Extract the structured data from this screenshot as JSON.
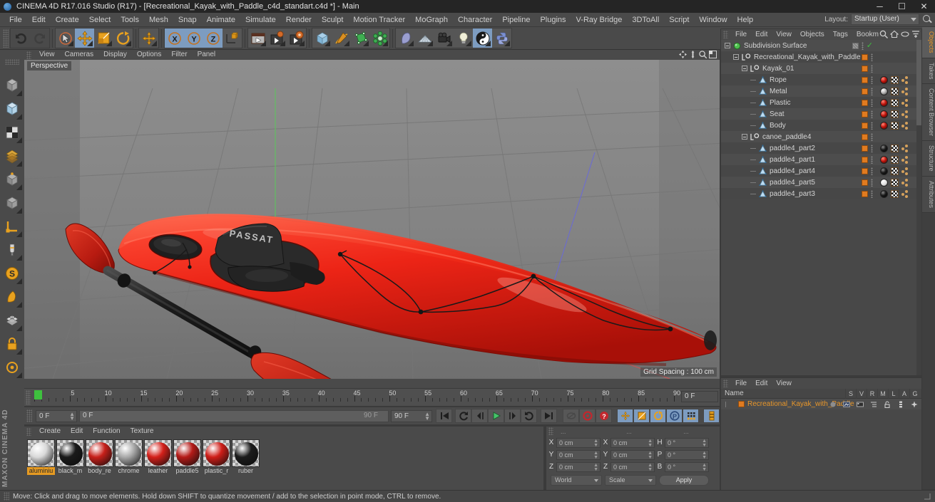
{
  "window": {
    "title": "CINEMA 4D R17.016 Studio (R17) - [Recreational_Kayak_with_Paddle_c4d_standart.c4d *] - Main",
    "minimize": "─",
    "maximize": "☐",
    "close": "✕"
  },
  "menubar": {
    "items": [
      "File",
      "Edit",
      "Create",
      "Select",
      "Tools",
      "Mesh",
      "Snap",
      "Animate",
      "Simulate",
      "Render",
      "Sculpt",
      "Motion Tracker",
      "MoGraph",
      "Character",
      "Pipeline",
      "Plugins",
      "V-Ray Bridge",
      "3DToAll",
      "Script",
      "Window",
      "Help"
    ],
    "layout_label": "Layout:",
    "layout_value": "Startup (User)"
  },
  "viewport": {
    "menu": [
      "View",
      "Cameras",
      "Display",
      "Options",
      "Filter",
      "Panel"
    ],
    "label": "Perspective",
    "grid_spacing": "Grid Spacing : 100 cm",
    "axis_x": "X",
    "axis_y": "Y",
    "axis_z": "Z",
    "hud_logo": "PASSAT"
  },
  "timeline": {
    "ticks": [
      0,
      5,
      10,
      15,
      20,
      25,
      30,
      35,
      40,
      45,
      50,
      55,
      60,
      65,
      70,
      75,
      80,
      85,
      90
    ],
    "current_frame_field": "0 F",
    "range_start": "0 F",
    "range_min": "0 F",
    "range_max": "90 F",
    "range_end": "90 F"
  },
  "material_manager": {
    "menu": [
      "Create",
      "Edit",
      "Function",
      "Texture"
    ],
    "materials": [
      {
        "name": "aluminiu",
        "color": "#d9d9d9",
        "selected": true
      },
      {
        "name": "black_m",
        "color": "#1a1a1a",
        "selected": false
      },
      {
        "name": "body_re",
        "color": "#c7201a",
        "selected": false
      },
      {
        "name": "chrome",
        "color": "#a9a9a9",
        "selected": false
      },
      {
        "name": "leather",
        "color": "#d4201a",
        "selected": false
      },
      {
        "name": "paddle5",
        "color": "#b51b18",
        "selected": false
      },
      {
        "name": "plastic_r",
        "color": "#cf1e18",
        "selected": false
      },
      {
        "name": "ruber",
        "color": "#1c1c1c",
        "selected": false
      }
    ]
  },
  "coordinates": {
    "header": [
      "...",
      "...",
      "..."
    ],
    "rows": [
      {
        "label1": "X",
        "value1": "0 cm",
        "label2": "X",
        "value2": "0 cm",
        "label3": "H",
        "value3": "0 °"
      },
      {
        "label1": "Y",
        "value1": "0 cm",
        "label2": "Y",
        "value2": "0 cm",
        "label3": "P",
        "value3": "0 °"
      },
      {
        "label1": "Z",
        "value1": "0 cm",
        "label2": "Z",
        "value2": "0 cm",
        "label3": "B",
        "value3": "0 °"
      }
    ],
    "world_select": "World",
    "scale_select": "Scale",
    "apply_button": "Apply"
  },
  "object_manager": {
    "menu": [
      "File",
      "Edit",
      "View",
      "Objects",
      "Tags",
      "Bookm"
    ],
    "rows": [
      {
        "label": "Subdivision Surface",
        "depth": 0,
        "expander": "minus",
        "icon": "subdivision-surface-icon",
        "tags": [],
        "orange": false,
        "check": true
      },
      {
        "label": "Recreational_Kayak_with_Paddle",
        "depth": 1,
        "expander": "minus",
        "icon": "null-object-icon",
        "tags": [],
        "orange": true
      },
      {
        "label": "Kayak_01",
        "depth": 2,
        "expander": "minus",
        "icon": "null-object-icon",
        "tags": [],
        "orange": true
      },
      {
        "label": "Rope",
        "depth": 3,
        "expander": "none",
        "icon": "polygon-object-icon",
        "tags": [
          "mat-red",
          "checker",
          "chain"
        ],
        "orange": true
      },
      {
        "label": "Metal",
        "depth": 3,
        "expander": "none",
        "icon": "polygon-object-icon",
        "tags": [
          "mat-silver",
          "checker",
          "chain"
        ],
        "orange": true
      },
      {
        "label": "Plastic",
        "depth": 3,
        "expander": "none",
        "icon": "polygon-object-icon",
        "tags": [
          "mat-red",
          "checker",
          "chain"
        ],
        "orange": true
      },
      {
        "label": "Seat",
        "depth": 3,
        "expander": "none",
        "icon": "polygon-object-icon",
        "tags": [
          "mat-red",
          "checker",
          "chain"
        ],
        "orange": true
      },
      {
        "label": "Body",
        "depth": 3,
        "expander": "none",
        "icon": "polygon-object-icon",
        "tags": [
          "mat-red",
          "checker",
          "chain"
        ],
        "orange": true
      },
      {
        "label": "canoe_paddle4",
        "depth": 2,
        "expander": "minus",
        "icon": "null-object-icon",
        "tags": [],
        "orange": true
      },
      {
        "label": "paddle4_part2",
        "depth": 3,
        "expander": "none",
        "icon": "polygon-object-icon",
        "tags": [
          "mat-black",
          "checker",
          "chain"
        ],
        "orange": true
      },
      {
        "label": "paddle4_part1",
        "depth": 3,
        "expander": "none",
        "icon": "polygon-object-icon",
        "tags": [
          "mat-red",
          "checker",
          "chain"
        ],
        "orange": true
      },
      {
        "label": "paddle4_part4",
        "depth": 3,
        "expander": "none",
        "icon": "polygon-object-icon",
        "tags": [
          "mat-black",
          "checker",
          "chain"
        ],
        "orange": true
      },
      {
        "label": "paddle4_part5",
        "depth": 3,
        "expander": "none",
        "icon": "polygon-object-icon",
        "tags": [
          "mat-white",
          "checker",
          "chain"
        ],
        "orange": true
      },
      {
        "label": "paddle4_part3",
        "depth": 3,
        "expander": "none",
        "icon": "polygon-object-icon",
        "tags": [
          "mat-black",
          "checker",
          "chain"
        ],
        "orange": true
      }
    ]
  },
  "layer_manager": {
    "menu": [
      "File",
      "Edit",
      "View"
    ],
    "name_header": "Name",
    "columns": [
      "S",
      "V",
      "R",
      "M",
      "L",
      "A",
      "G"
    ],
    "rows": [
      {
        "label": "Recreational_Kayak_with_Paddle",
        "color": "#e07b20"
      }
    ]
  },
  "vertical_tabs": [
    {
      "label": "Objects",
      "active": true
    },
    {
      "label": "Takes",
      "active": false
    },
    {
      "label": "Content Browser",
      "active": false
    },
    {
      "label": "Structure",
      "active": false
    },
    {
      "label": "Attributes",
      "active": false
    }
  ],
  "statusbar": {
    "text": "Move: Click and drag to move elements. Hold down SHIFT to quantize movement / add to the selection in point mode, CTRL to remove."
  },
  "left_palette": {
    "tools": [
      "magnet-icon",
      "cube-primitive-icon",
      "array-icon",
      "deformer-icon",
      "generator-icon",
      "spline-icon",
      "nurbs-icon",
      "axis-icon",
      "brush-icon",
      "sculpt-icon",
      "knife-icon",
      "checker-icon",
      "lock-icon",
      "settings-icon"
    ]
  },
  "brand": "MAXON CINEMA 4D",
  "colors": {
    "accent_orange": "#e8962a",
    "active_blue": "#7d9cc0",
    "panel_bg": "#4a4a4a",
    "kayak_red": "#e0241c"
  }
}
